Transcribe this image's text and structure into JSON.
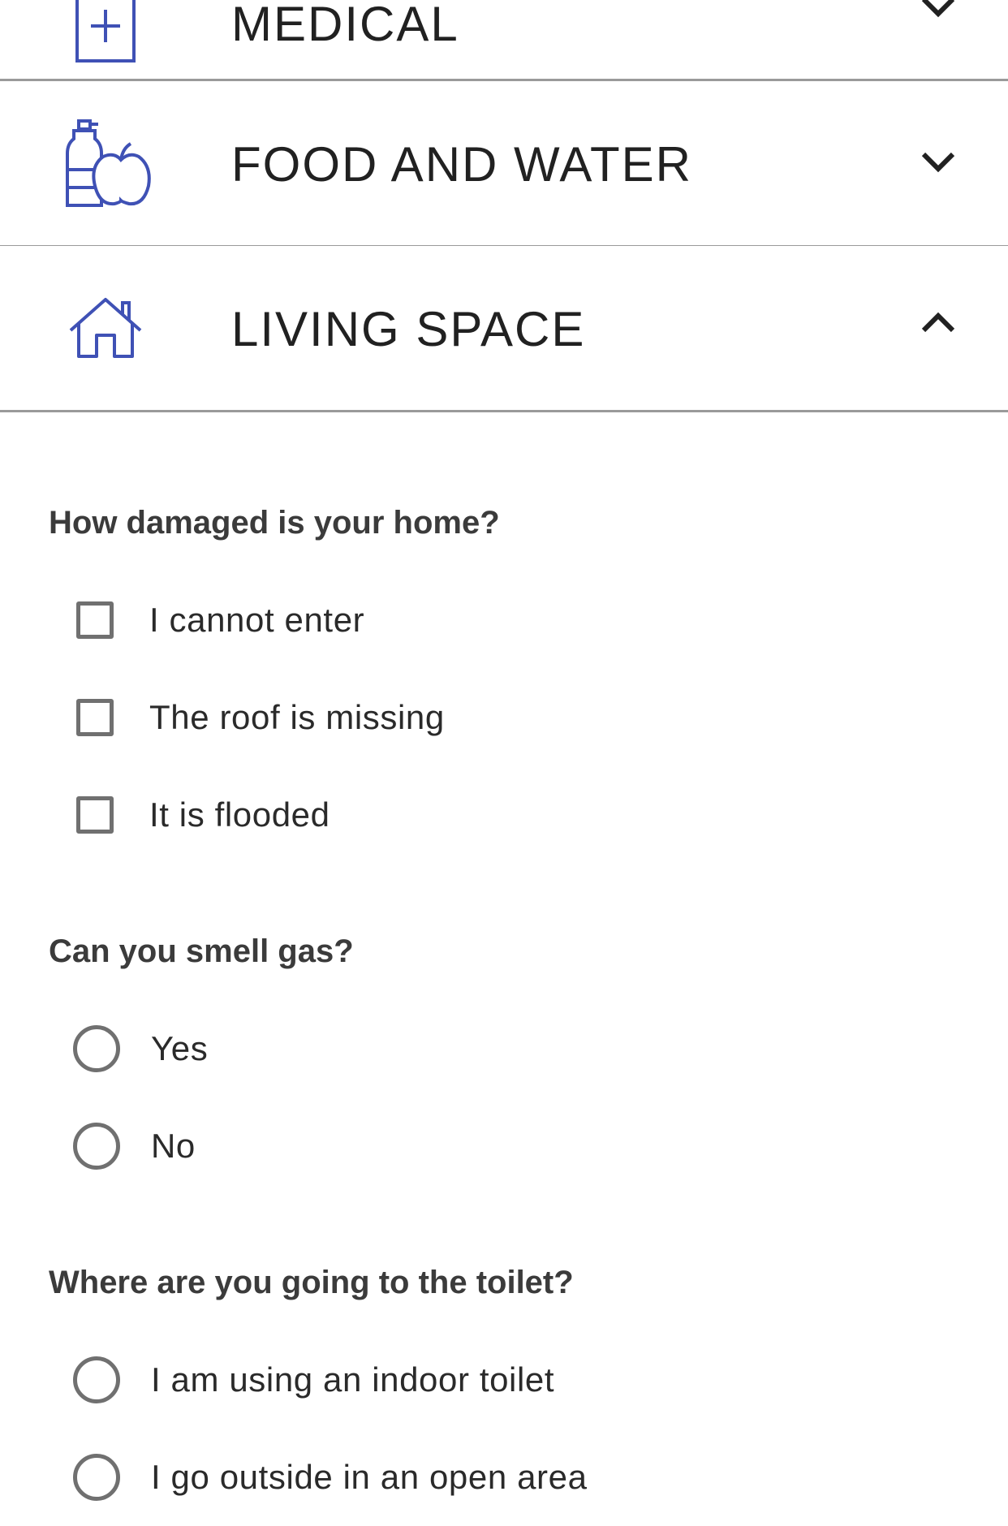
{
  "sections": [
    {
      "title": "MEDICAL",
      "icon": "medical-kit-icon",
      "expanded": false
    },
    {
      "title": "FOOD AND WATER",
      "icon": "water-bottle-apple-icon",
      "expanded": false
    },
    {
      "title": "LIVING SPACE",
      "icon": "house-icon",
      "expanded": true
    }
  ],
  "living_space": {
    "questions": [
      {
        "label": "How damaged is your home?",
        "type": "checkbox",
        "options": [
          "I cannot enter",
          "The roof is missing",
          "It is flooded"
        ]
      },
      {
        "label": "Can you smell gas?",
        "type": "radio",
        "options": [
          "Yes",
          "No"
        ]
      },
      {
        "label": "Where are you going to the toilet?",
        "type": "radio",
        "options": [
          "I am using an indoor toilet",
          "I go outside in an open area"
        ]
      }
    ]
  },
  "colors": {
    "icon_accent": "#3f51b5",
    "divider": "#9a9a9a",
    "control_border": "#707070"
  }
}
